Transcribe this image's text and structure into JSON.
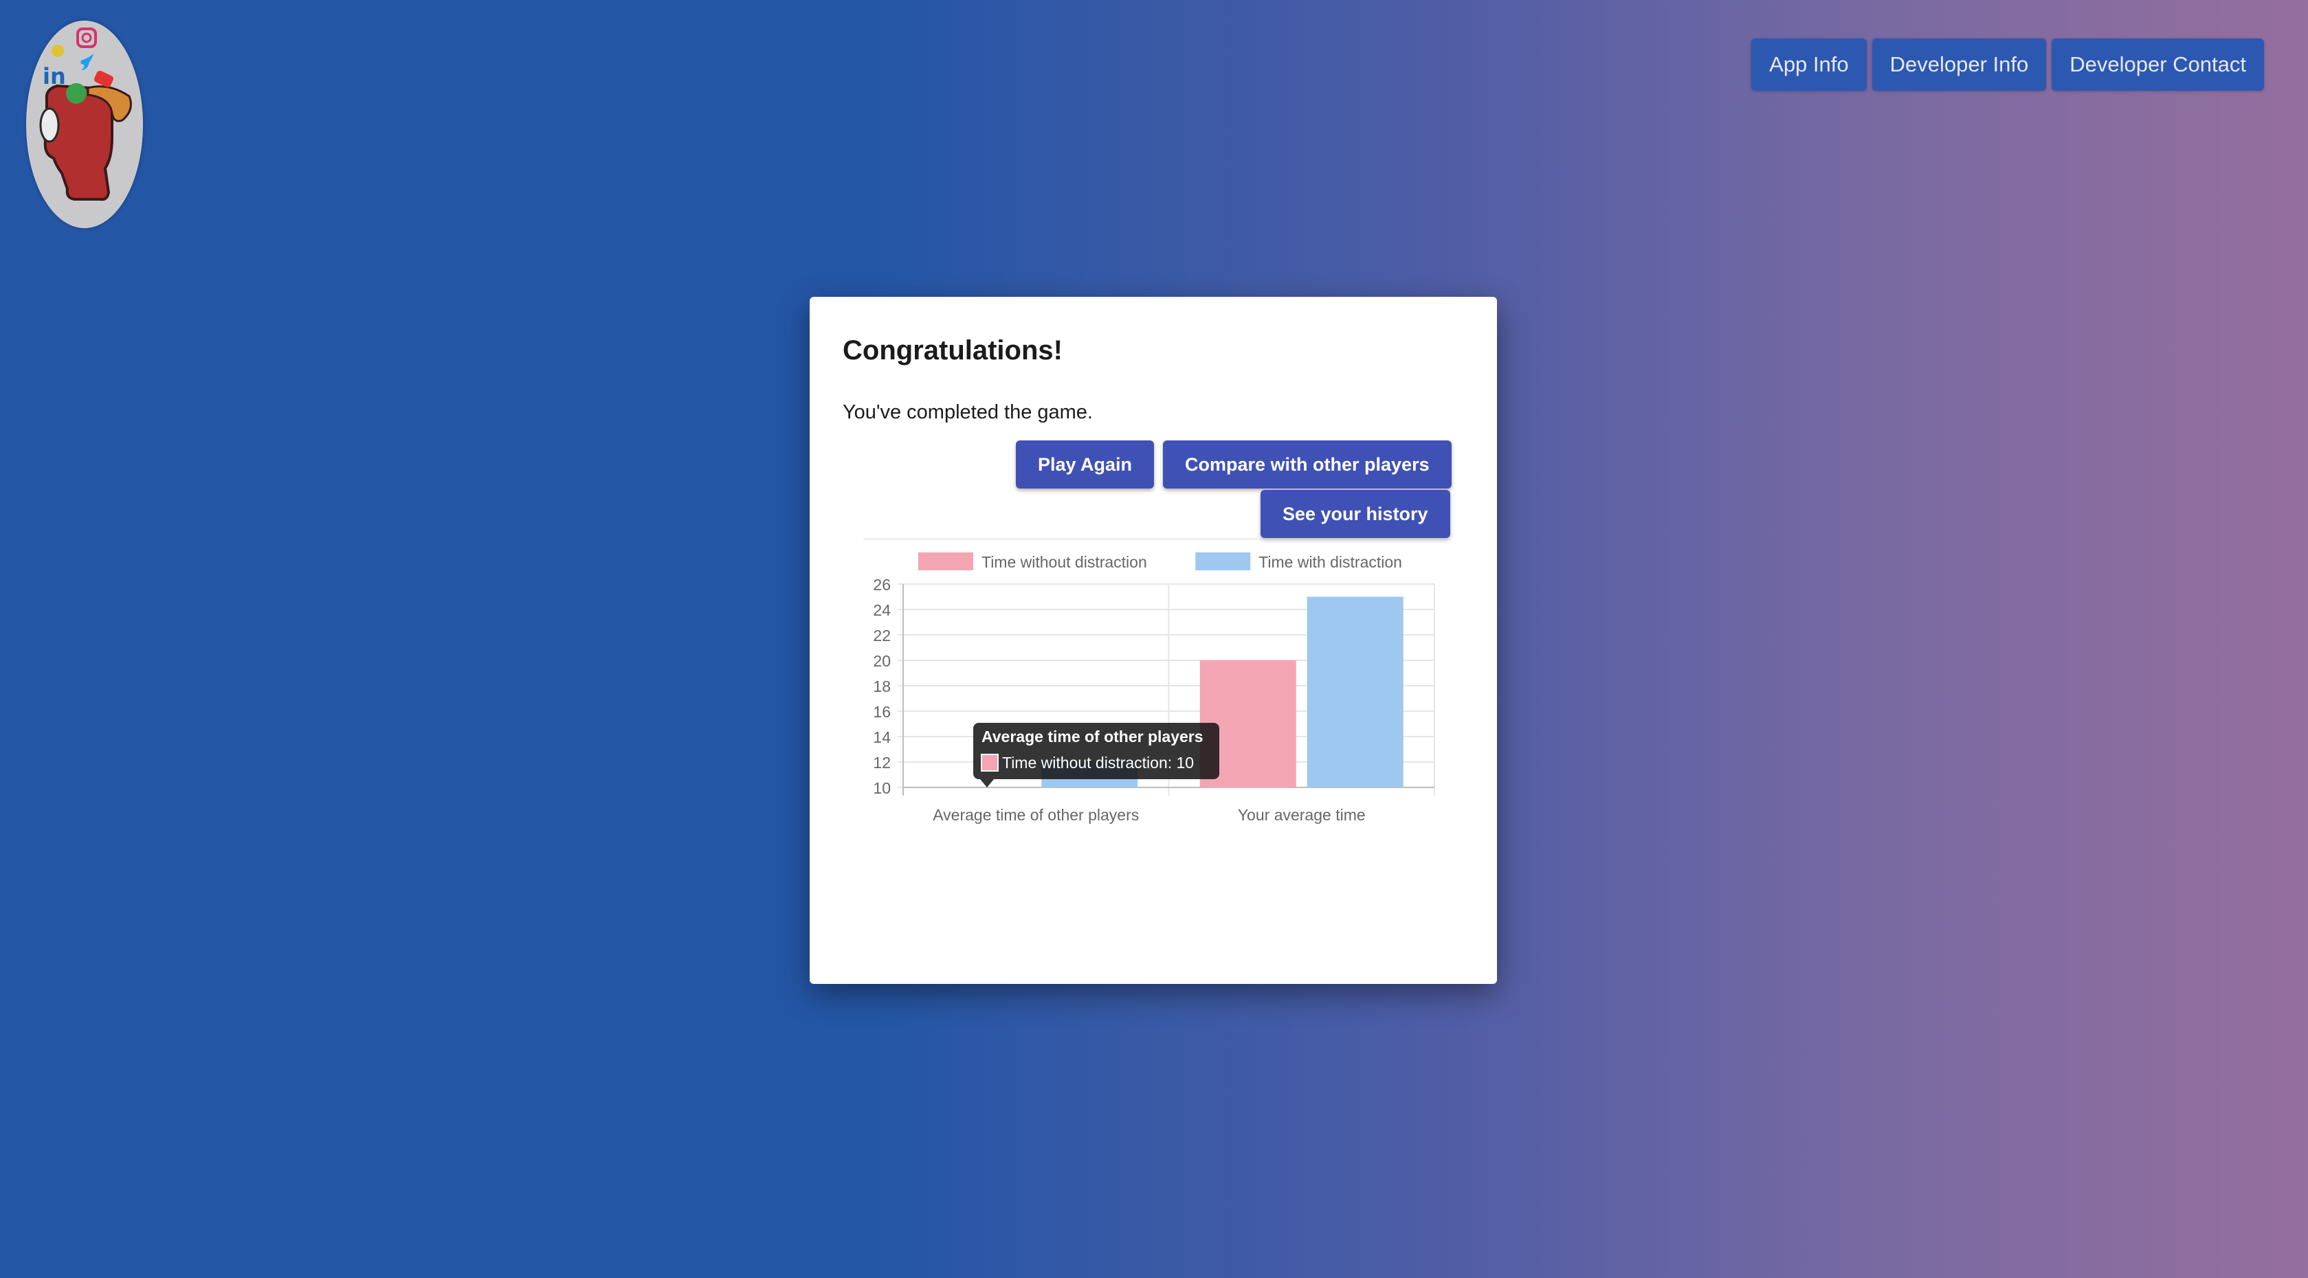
{
  "nav": {
    "app_info": "App Info",
    "developer_info": "Developer Info",
    "developer_contact": "Developer Contact"
  },
  "dialog": {
    "title": "Congratulations!",
    "message": "You've completed the game.",
    "play_again": "Play Again",
    "compare": "Compare with other players",
    "history": "See your history"
  },
  "chart_data": {
    "type": "bar",
    "categories": [
      "Average time of other players",
      "Your average time"
    ],
    "series": [
      {
        "name": "Time without distraction",
        "values": [
          10,
          20
        ],
        "color": "#f4a5b4"
      },
      {
        "name": "Time with distraction",
        "values": [
          12,
          25
        ],
        "color": "#9ec8ef"
      }
    ],
    "ylim": [
      10,
      26
    ],
    "yticks": [
      10,
      12,
      14,
      16,
      18,
      20,
      22,
      24,
      26
    ],
    "grid": true,
    "legend": "top",
    "tooltip": {
      "title": "Average time of other players",
      "label": "Time without distraction: 10"
    }
  },
  "colors": {
    "button": "#3f51b5",
    "nav_button": "#2d58b2"
  }
}
